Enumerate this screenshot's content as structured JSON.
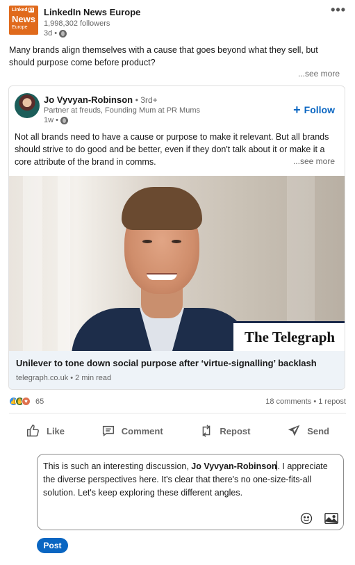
{
  "post": {
    "author": {
      "logo_line1": "Linked",
      "logo_in": "in",
      "logo_line2": "News",
      "logo_line3": "Europe",
      "name": "LinkedIn News Europe",
      "followers": "1,998,302 followers",
      "time": "3d •"
    },
    "commentary": "Many brands align themselves with a cause that goes beyond what they sell, but should purpose come before product?",
    "see_more": "...see more"
  },
  "shared": {
    "name": "Jo Vyvyan-Robinson",
    "degree": "• 3rd+",
    "headline": "Partner at freuds, Founding Mum at PR Mums",
    "time": "1w •",
    "follow": "Follow",
    "text": "Not all brands need to have a cause or purpose to make it relevant. But all brands should strive to do good and be better, even if they don't talk about it or make it a core attribute of the brand in comms.",
    "see_more": "...see more",
    "image_watermark": "The Telegraph",
    "article_title": "Unilever to tone down social purpose after ‘virtue-signalling’ backlash",
    "article_source": "telegraph.co.uk • 2 min read"
  },
  "social": {
    "reaction_count": "65",
    "comments_reposts": "18 comments • 1 repost"
  },
  "actions": {
    "like": "Like",
    "comment": "Comment",
    "repost": "Repost",
    "send": "Send"
  },
  "comment": {
    "before": "This is such an interesting discussion, ",
    "mention": "Jo Vyvyan-Robinson",
    "after": ". I appreciate the diverse perspectives here. It's clear that there's no one-size-fits-all solution. Let's keep exploring these different angles.",
    "post_label": "Post"
  },
  "colors": {
    "brand_blue": "#0a66c2",
    "news_orange": "#e06a1c"
  },
  "icons": [
    "more-menu-icon",
    "globe-icon",
    "plus-icon",
    "like-icon",
    "comment-icon",
    "repost-icon",
    "send-icon",
    "emoji-icon",
    "image-icon"
  ]
}
